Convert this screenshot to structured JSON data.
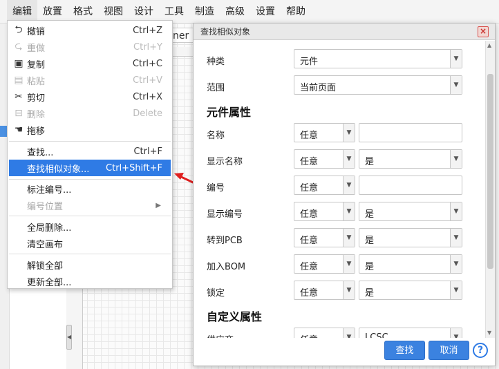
{
  "menubar": {
    "items": [
      "编辑",
      "放置",
      "格式",
      "视图",
      "设计",
      "工具",
      "制造",
      "高级",
      "设置",
      "帮助"
    ]
  },
  "background": {
    "tab_text": "ner -"
  },
  "edit_menu": {
    "items": [
      {
        "icon": "undo-icon",
        "glyph": "⮌",
        "label": "撤销",
        "shortcut": "Ctrl+Z",
        "disabled": false
      },
      {
        "icon": "redo-icon",
        "glyph": "⮎",
        "label": "重做",
        "shortcut": "Ctrl+Y",
        "disabled": true
      },
      {
        "icon": "copy-icon",
        "glyph": "▣",
        "label": "复制",
        "shortcut": "Ctrl+C",
        "disabled": false
      },
      {
        "icon": "paste-icon",
        "glyph": "📋",
        "label": "粘贴",
        "shortcut": "Ctrl+V",
        "disabled": true
      },
      {
        "icon": "scissors-icon",
        "glyph": "✂",
        "label": "剪切",
        "shortcut": "Ctrl+X",
        "disabled": false
      },
      {
        "icon": "trash-icon",
        "glyph": "🗑",
        "label": "删除",
        "shortcut": "Delete",
        "disabled": true
      },
      {
        "icon": "hand-icon",
        "glyph": "✋",
        "label": "拖移",
        "shortcut": "",
        "disabled": false
      },
      {
        "label": "查找...",
        "shortcut": "Ctrl+F",
        "disabled": false
      },
      {
        "label": "查找相似对象...",
        "shortcut": "Ctrl+Shift+F",
        "disabled": false,
        "highlighted": true
      },
      {
        "label": "标注编号...",
        "shortcut": "",
        "disabled": false
      },
      {
        "label": "编号位置",
        "shortcut": "",
        "disabled": true,
        "submenu": true
      },
      {
        "label": "全局删除...",
        "shortcut": "",
        "disabled": false
      },
      {
        "label": "清空画布",
        "shortcut": "",
        "disabled": false
      },
      {
        "label": "解锁全部",
        "shortcut": "",
        "disabled": false
      },
      {
        "label": "更新全部...",
        "shortcut": "",
        "disabled": false
      }
    ]
  },
  "dialog": {
    "title": "查找相似对象",
    "rows": {
      "kind": {
        "label": "种类",
        "value": "元件"
      },
      "scope": {
        "label": "范围",
        "value": "当前页面"
      }
    },
    "section_component": "元件属性",
    "attrs": [
      {
        "label": "名称",
        "match": "任意",
        "value": ""
      },
      {
        "label": "显示名称",
        "match": "任意",
        "value": "是"
      },
      {
        "label": "编号",
        "match": "任意",
        "value": ""
      },
      {
        "label": "显示编号",
        "match": "任意",
        "value": "是"
      },
      {
        "label": "转到PCB",
        "match": "任意",
        "value": "是"
      },
      {
        "label": "加入BOM",
        "match": "任意",
        "value": "是"
      },
      {
        "label": "锁定",
        "match": "任意",
        "value": "是"
      }
    ],
    "section_custom": "自定义属性",
    "custom_partial": {
      "label": "供应商",
      "match": "任意",
      "value": "LCSC"
    },
    "find_label": "查找",
    "cancel_label": "取消",
    "help_label": "?",
    "close_label": "×"
  },
  "colors": {
    "accent": "#2f7be5",
    "arrow": "#e02020"
  }
}
